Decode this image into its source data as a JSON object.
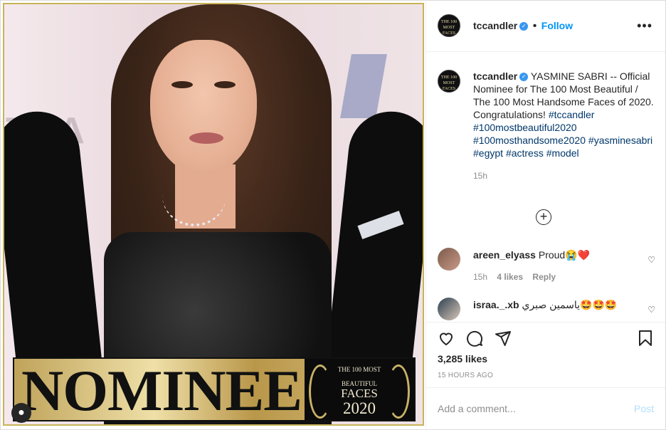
{
  "post": {
    "username": "tccandler",
    "follow_label": "Follow",
    "more_label": "•••",
    "avatar_text": "THE 100 MOST FACES",
    "caption_text": " YASMINE SABRI -- Official Nominee for The 100 Most Beautiful / The 100 Most Handsome Faces of 2020. Congratulations! ",
    "hashtags": [
      "#tccandler",
      "#100mostbeautiful2020",
      "#100mosthandsome2020",
      "#yasminesabri",
      "#egypt",
      "#actress",
      "#model"
    ],
    "caption_time": "15h",
    "load_more": "+"
  },
  "image": {
    "bg_text": "TRA",
    "nominee": "NOMINEE",
    "badge_line1": "THE 100 MOST",
    "badge_line2": "BEAUTIFUL",
    "badge_line3": "FACES",
    "badge_year": "2020"
  },
  "comments": [
    {
      "user": "areen_elyass",
      "text": "Proud😭❤️",
      "time": "15h",
      "likes": "4 likes",
      "reply": "Reply"
    },
    {
      "user": "israa._.xb",
      "text": "ياسمين صبري🤩🤩🤩",
      "time": "",
      "likes": "",
      "reply": ""
    }
  ],
  "footer": {
    "likes": "3,285 likes",
    "ago": "15 HOURS AGO",
    "add_comment_placeholder": "Add a comment...",
    "post_label": "Post"
  },
  "icons": {
    "heart": "heart-icon",
    "comment": "comment-icon",
    "share": "share-icon",
    "bookmark": "bookmark-icon"
  }
}
